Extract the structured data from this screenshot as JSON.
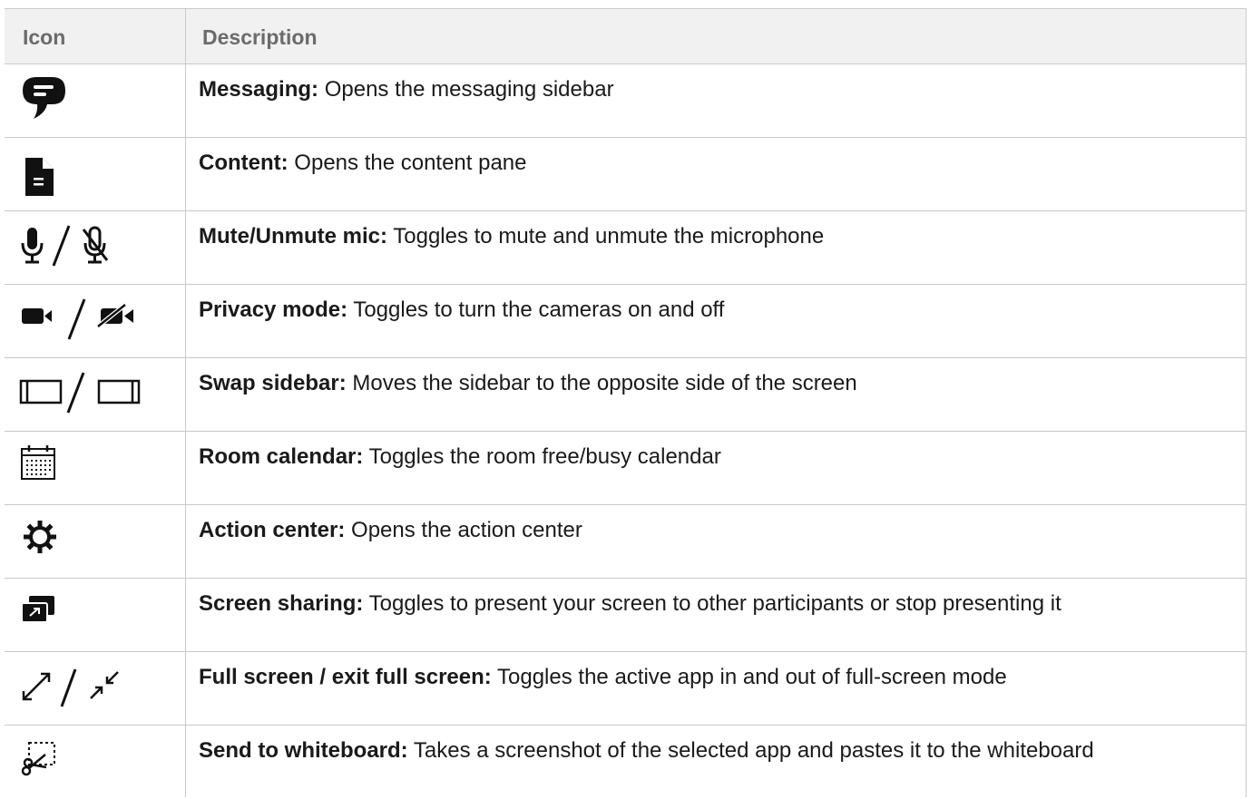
{
  "header": {
    "icon_col": "Icon",
    "desc_col": "Description"
  },
  "rows": [
    {
      "icon": "messaging-icon",
      "title": "Messaging:",
      "text": " Opens the messaging sidebar"
    },
    {
      "icon": "content-icon",
      "title": "Content:",
      "text": " Opens the content pane"
    },
    {
      "icon": "mic-mute-unmute-icon",
      "title": "Mute/Unmute mic:",
      "text": " Toggles to mute and unmute the microphone"
    },
    {
      "icon": "camera-privacy-icon",
      "title": "Privacy mode:",
      "text": " Toggles to turn the cameras on and off"
    },
    {
      "icon": "swap-sidebar-icon",
      "title": "Swap sidebar:",
      "text": " Moves the sidebar to the opposite side of the screen"
    },
    {
      "icon": "calendar-icon",
      "title": "Room calendar:",
      "text": " Toggles the room free/busy calendar"
    },
    {
      "icon": "gear-icon",
      "title": "Action center:",
      "text": " Opens the action center"
    },
    {
      "icon": "screen-share-icon",
      "title": "Screen sharing:",
      "text": " Toggles to present your screen to other participants or stop presenting it"
    },
    {
      "icon": "fullscreen-icon",
      "title": "Full screen / exit full screen:",
      "text": " Toggles the active app in and out of full-screen mode"
    },
    {
      "icon": "send-to-whiteboard-icon",
      "title": "Send to whiteboard:",
      "text": " Takes a screenshot of the selected app and pastes it to the whiteboard"
    }
  ]
}
